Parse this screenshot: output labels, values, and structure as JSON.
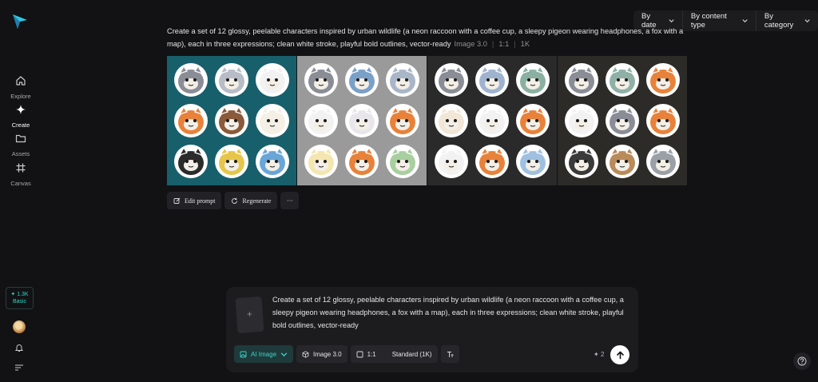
{
  "sidebar": {
    "items": [
      {
        "label": "Explore",
        "icon": "home-icon"
      },
      {
        "label": "Create",
        "icon": "sparkle-icon"
      },
      {
        "label": "Assets",
        "icon": "folder-icon"
      },
      {
        "label": "Canvas",
        "icon": "canvas-grid-icon"
      }
    ],
    "credits": {
      "value": "1.3K",
      "plan": "Basic"
    }
  },
  "filters": [
    {
      "label": "By date"
    },
    {
      "label": "By content type"
    },
    {
      "label": "By category"
    }
  ],
  "generation": {
    "prompt": "Create a set of 12 glossy, peelable characters inspired by urban wildlife (a neon raccoon with a coffee cup, a sleepy pigeon wearing headphones, a fox with a map), each in three expressions; clean white stroke, playful bold outlines, vector-ready",
    "model": "Image 3.0",
    "ratio": "1:1",
    "quality": "1K",
    "images": [
      {
        "bg": "#175f6b"
      },
      {
        "bg": "#9a9a9a"
      },
      {
        "bg": "#2a2a2a"
      },
      {
        "bg": "#2c2b28"
      }
    ],
    "actions": {
      "edit": "Edit prompt",
      "regenerate": "Regenerate",
      "more": "···"
    }
  },
  "composer": {
    "text": "Create a set of 12 glossy, peelable characters inspired by urban wildlife (a neon raccoon with a coffee cup, a sleepy pigeon wearing headphones, a fox with a map), each in three expressions; clean white stroke, playful bold outlines, vector-ready",
    "mode": "AI Image",
    "model": "Image 3.0",
    "ratio": "1:1",
    "quality": "Standard (1K)",
    "cost": "2",
    "upload_glyph": "+"
  },
  "colors": {
    "accent": "#2fd6c5",
    "bg": "#121214",
    "panel": "#1c1c1f"
  }
}
